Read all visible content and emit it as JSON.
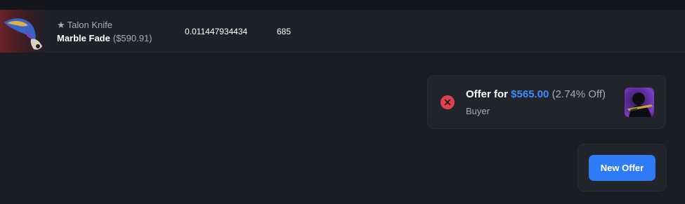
{
  "item": {
    "star_icon": "star-icon",
    "name": "Talon Knife",
    "skin": "Marble Fade",
    "price": "($590.91)",
    "float_value": "0.011447934434",
    "pattern": "685"
  },
  "offer": {
    "prefix": "Offer for",
    "amount": "$565.00",
    "discount": "(2.74% Off)",
    "role": "Buyer",
    "close_icon": "close-icon",
    "colors": {
      "amount": "#3d8bff",
      "close": "#e0434f"
    }
  },
  "actions": {
    "new_offer_label": "New Offer",
    "button_color": "#2e7bf6"
  }
}
